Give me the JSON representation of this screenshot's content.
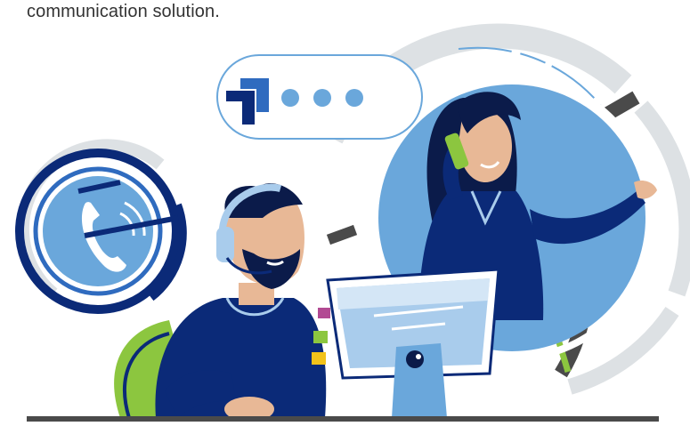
{
  "caption": {
    "text": "communication solution."
  },
  "illustration": {
    "subject": "call-center",
    "icons": [
      "phone-handset-icon",
      "chat-bubble-icon",
      "brand-logo-icon",
      "monitor-icon",
      "headset-icon"
    ],
    "colors": {
      "navy": "#0b2a78",
      "blue": "#2f6bbf",
      "light_blue": "#6aa7db",
      "pale_blue": "#a9ccec",
      "grey_ring": "#dde1e4",
      "dark_grey": "#4a4a4a",
      "lime": "#8cc63f",
      "skin": "#e8b896",
      "magenta": "#b24a93",
      "yellow": "#f2c21a"
    }
  }
}
